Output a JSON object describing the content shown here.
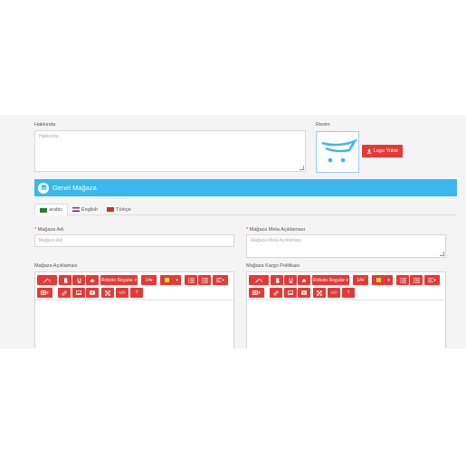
{
  "about": {
    "label": "Hakkında",
    "placeholder": "Hakkında"
  },
  "image": {
    "label": "Resim",
    "upload_label": "Logo Yükle"
  },
  "store_section": {
    "title": "Genel Mağaza"
  },
  "tabs": [
    {
      "label": "arabic"
    },
    {
      "label": "English"
    },
    {
      "label": "Türkçe"
    }
  ],
  "store_name": {
    "label": "Mağaza Adı",
    "placeholder": "Mağaza Adı"
  },
  "store_meta": {
    "label": "Mağaza Meta Açıklaması",
    "placeholder": "Mağaza Meta Açıklaması"
  },
  "store_description": {
    "label": "Mağaza Açıklaması"
  },
  "shipping_policy": {
    "label": "Mağaza Kargo Politikası"
  },
  "toolbar": {
    "font_name": "Roboto Regular",
    "font_size": "14"
  },
  "colors": {
    "accent": "#e53935",
    "primary": "#39b8ef",
    "highlight": "#fdd835"
  }
}
